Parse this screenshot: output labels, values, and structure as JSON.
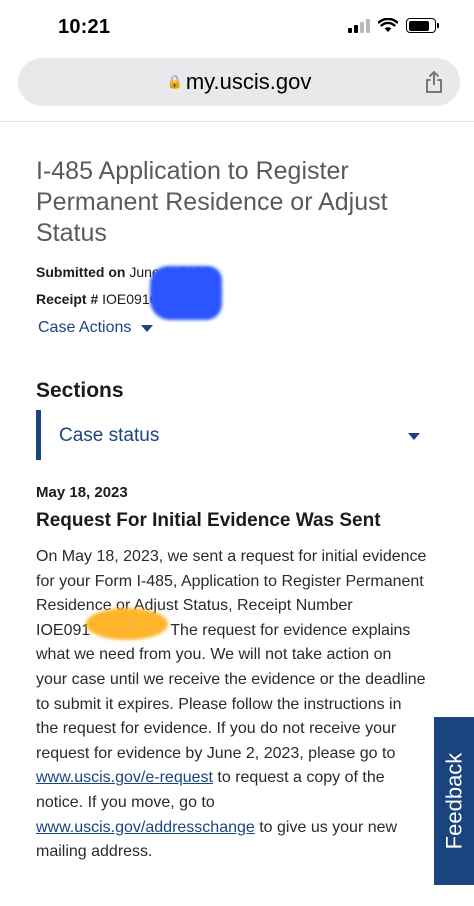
{
  "status_bar": {
    "time": "10:21"
  },
  "browser": {
    "url": "my.uscis.gov"
  },
  "case": {
    "title": "I-485 Application to Register Permanent Residence or Adjust Status",
    "submitted_label": "Submitted on",
    "submitted_value": "June 1, 2022",
    "receipt_label": "Receipt #",
    "receipt_value": "IOE0916",
    "case_actions_label": "Case Actions"
  },
  "sections": {
    "heading": "Sections",
    "selected": "Case status"
  },
  "status": {
    "date": "May 18, 2023",
    "heading": "Request For Initial Evidence Was Sent",
    "lines": [
      "On May 18, 2023, we sent a request for initial evidence",
      "for your Form I-485, Application to Register Permanent",
      "Residence or Adjust Status, Receipt Number",
      "IOE091",
      "The request for evidence explains",
      "what we need from you. We will not take action on",
      "your case until we receive the evidence or the deadline",
      "to submit it expires. Please follow the instructions in",
      "the request for evidence. If you do not receive your",
      "request for evidence by June 2, 2023, please go to",
      "www.uscis.gov/e-request",
      " to request a copy of the",
      "notice. If you move, go to",
      "www.uscis.gov/addresschange",
      " to give us your new",
      "mailing address."
    ]
  },
  "feedback_label": "Feedback",
  "colors": {
    "brand_blue": "#1a4480",
    "url_bar": "#e9e9eb",
    "redact_blue": "#2b55ff",
    "redact_orange": "#ffb11f"
  },
  "icons": [
    "cellular-signal-icon",
    "wifi-icon",
    "battery-icon",
    "lock-icon",
    "share-icon",
    "chevron-down-icon"
  ]
}
